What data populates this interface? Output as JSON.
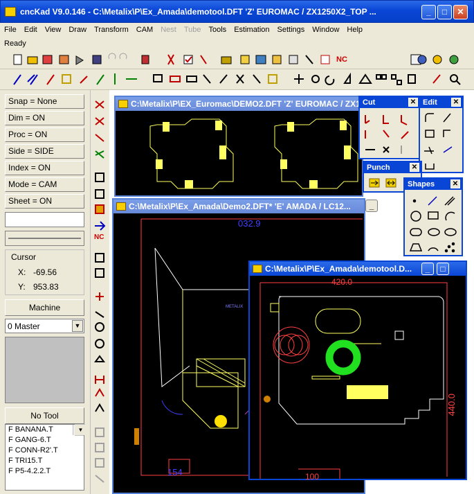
{
  "app": {
    "title": "cncKad V9.0.146 - C:\\Metalix\\P\\Ex_Amada\\demotool.DFT  'Z'  EUROMAC / ZX1250X2_TOP ...",
    "minimize": "_",
    "maximize": "□",
    "close": "✕"
  },
  "menu": [
    {
      "label": "File",
      "disabled": false
    },
    {
      "label": "Edit",
      "disabled": false
    },
    {
      "label": "View",
      "disabled": false
    },
    {
      "label": "Draw",
      "disabled": false
    },
    {
      "label": "Transform",
      "disabled": false
    },
    {
      "label": "CAM",
      "disabled": false
    },
    {
      "label": "Nest",
      "disabled": true
    },
    {
      "label": "Tube",
      "disabled": true
    },
    {
      "label": "Tools",
      "disabled": false
    },
    {
      "label": "Estimation",
      "disabled": false
    },
    {
      "label": "Settings",
      "disabled": false
    },
    {
      "label": "Window",
      "disabled": false
    },
    {
      "label": "Help",
      "disabled": false
    }
  ],
  "status": {
    "text": "Ready"
  },
  "toolbar": {
    "nc_label": "NC"
  },
  "left": {
    "snap": "Snap = None",
    "dim": "Dim   = ON",
    "proc": "Proc  = ON",
    "side": "Side  = SIDE",
    "index": "Index = ON",
    "mode": "Mode = CAM",
    "sheet": "Sheet = ON",
    "cursor_label": "Cursor",
    "x_label": "X:",
    "x_value": "-69.56",
    "y_label": "Y:",
    "y_value": "953.83",
    "machine": "Machine",
    "master": "0 Master",
    "no_tool": "No Tool",
    "tools": [
      "F BANANA.T",
      "F GANG-6.T",
      "F CONN-R2'.T",
      "F TRI15.T",
      "F P5-4.2.2.T"
    ]
  },
  "vtool": {
    "nc_label": "NC"
  },
  "docs": {
    "demo2_euromac": "C:\\Metalix\\P\\EX_Euromac\\DEMO2.DFT  'Z'  EUROMAC / ZX1250X2_TOP",
    "demo2_amada": "C:\\Metalix\\P\\Ex_Amada\\Demo2.DFT*  'E'  AMADA / LC12...",
    "demotool": "C:\\Metalix\\P\\Ex_Amada\\demotool.D..."
  },
  "cad": {
    "dim_top": "032.9",
    "dim_bottom": "154",
    "metalix": "METALIX",
    "dim_top2": "420.0",
    "dim_side": "440.0",
    "dim_bottom2": "100"
  },
  "palettes": {
    "cut": "Cut",
    "edit": "Edit",
    "punch": "Punch",
    "shapes": "Shapes",
    "close": "✕"
  },
  "colors": {
    "title_active": "#0a46d6",
    "title_inactive": "#7b9ee8",
    "cad_bg": "#000000",
    "cad_yellow": "#ffff60",
    "cad_red": "#ff4040",
    "cad_green": "#20e020",
    "cad_blue": "#4040ff",
    "face": "#ece9d8"
  }
}
